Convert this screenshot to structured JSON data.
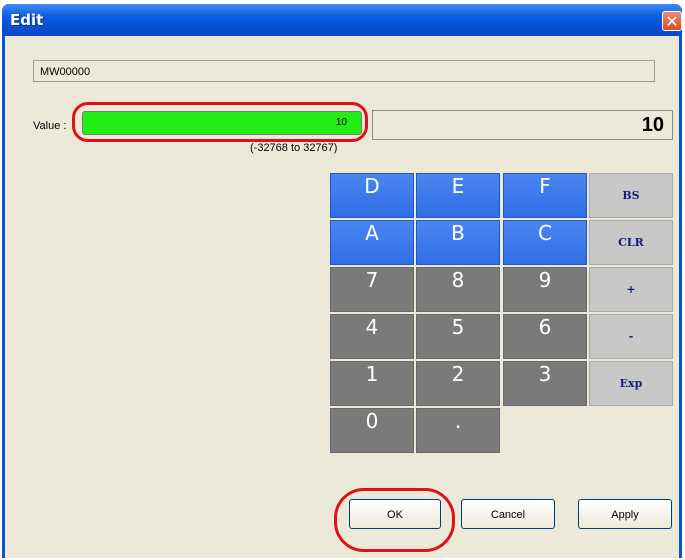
{
  "window": {
    "title": "Edit",
    "close_symbol": "✕"
  },
  "address": {
    "value": "MW00000"
  },
  "value": {
    "label": "Value :",
    "field_value": "10",
    "range": "(-32768 to 32767)",
    "display": "10"
  },
  "keypad": {
    "keys": [
      "D",
      "E",
      "F",
      "BS",
      "A",
      "B",
      "C",
      "CLR",
      "7",
      "8",
      "9",
      "+",
      "4",
      "5",
      "6",
      "-",
      "1",
      "2",
      "3",
      "Exp",
      "0",
      "."
    ]
  },
  "buttons": {
    "ok": "OK",
    "cancel": "Cancel",
    "apply": "Apply"
  },
  "colors": {
    "value_field": "#22ee14",
    "highlight": "#e0101a",
    "hex_keys": "#3a78ee",
    "digit_keys": "#7a7a7a",
    "func_keys": "#c8c8c8"
  },
  "icons": {
    "close": "close-icon"
  }
}
